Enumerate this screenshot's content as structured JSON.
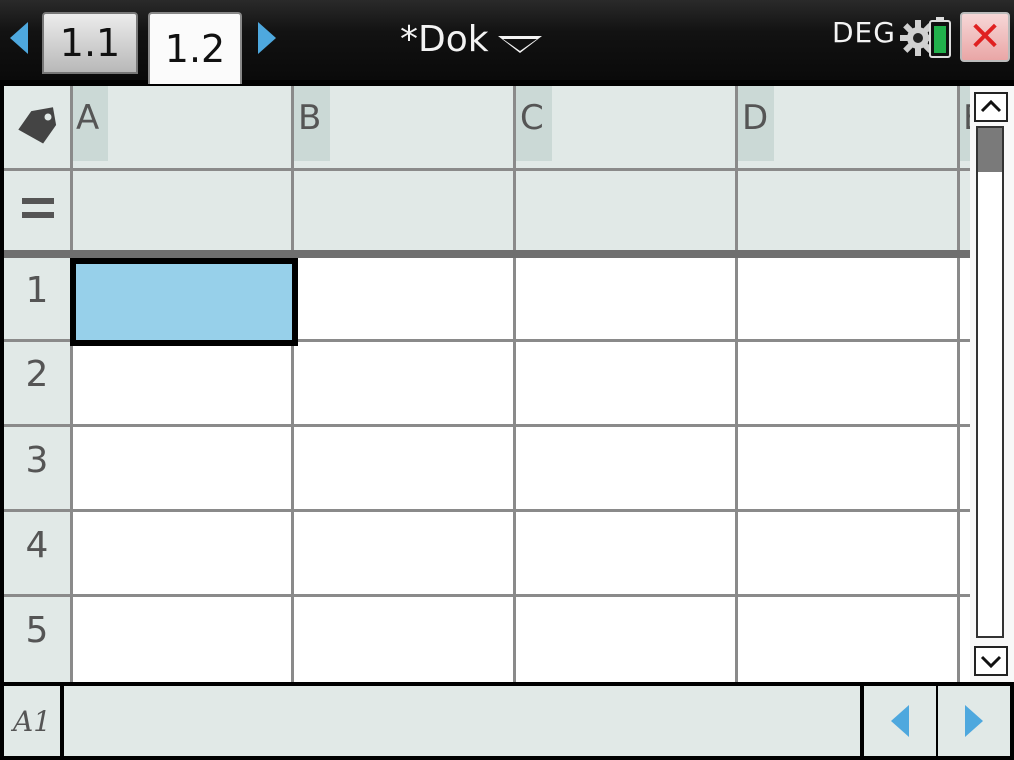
{
  "titlebar": {
    "tabs": [
      {
        "label": "1.1"
      },
      {
        "label": "1.2"
      }
    ],
    "document_title": "*Dok",
    "angle_mode": "DEG"
  },
  "spreadsheet": {
    "columns": [
      "A",
      "B",
      "C",
      "D"
    ],
    "partial_column": "E",
    "rows": [
      "1",
      "2",
      "3",
      "4",
      "5"
    ],
    "selected_cell": "A1"
  },
  "entry_line": {
    "cell_ref": "A1",
    "value": ""
  },
  "colors": {
    "selected_fill": "#97d0ea",
    "header_fill": "#e1e9e7",
    "accent": "#4ea8de"
  },
  "icons": {
    "tag": "tag-icon",
    "formula": "equals-icon",
    "battery": "battery-icon",
    "settings": "gear-icon",
    "close": "close-icon"
  }
}
